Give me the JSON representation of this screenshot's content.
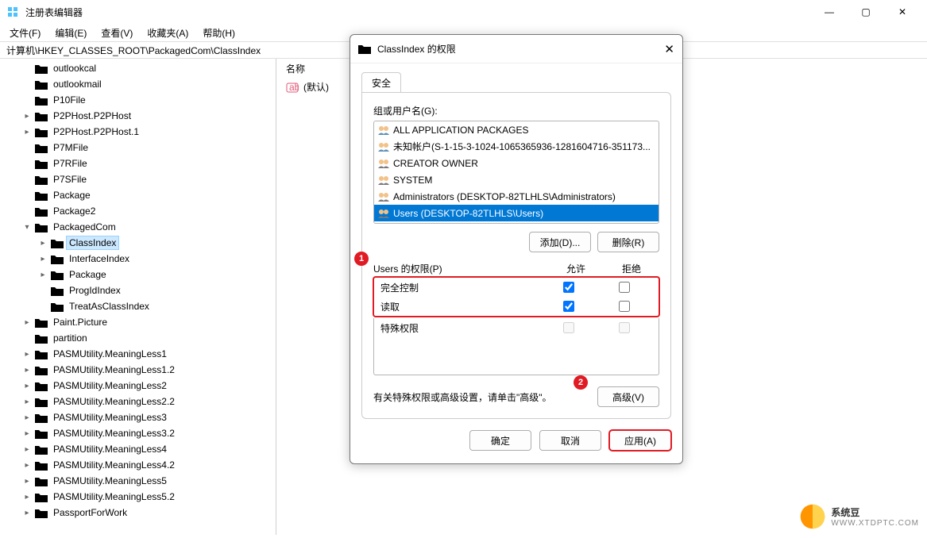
{
  "window": {
    "title": "注册表编辑器",
    "minimize": "—",
    "maximize": "▢",
    "close": "✕"
  },
  "menu": {
    "file": "文件(F)",
    "edit": "编辑(E)",
    "view": "查看(V)",
    "favorites": "收藏夹(A)",
    "help": "帮助(H)"
  },
  "address": "计算机\\HKEY_CLASSES_ROOT\\PackagedCom\\ClassIndex",
  "detail_header": {
    "name": "名称"
  },
  "detail_row": {
    "default": "(默认)"
  },
  "tree": [
    {
      "label": "outlookcal",
      "indent": 1,
      "caret": "none"
    },
    {
      "label": "outlookmail",
      "indent": 1,
      "caret": "none"
    },
    {
      "label": "P10File",
      "indent": 1,
      "caret": "none"
    },
    {
      "label": "P2PHost.P2PHost",
      "indent": 1,
      "caret": "right"
    },
    {
      "label": "P2PHost.P2PHost.1",
      "indent": 1,
      "caret": "right"
    },
    {
      "label": "P7MFile",
      "indent": 1,
      "caret": "none"
    },
    {
      "label": "P7RFile",
      "indent": 1,
      "caret": "none"
    },
    {
      "label": "P7SFile",
      "indent": 1,
      "caret": "none"
    },
    {
      "label": "Package",
      "indent": 1,
      "caret": "none"
    },
    {
      "label": "Package2",
      "indent": 1,
      "caret": "none"
    },
    {
      "label": "PackagedCom",
      "indent": 1,
      "caret": "down"
    },
    {
      "label": "ClassIndex",
      "indent": 2,
      "caret": "right",
      "selected": true
    },
    {
      "label": "InterfaceIndex",
      "indent": 2,
      "caret": "right"
    },
    {
      "label": "Package",
      "indent": 2,
      "caret": "right"
    },
    {
      "label": "ProgIdIndex",
      "indent": 2,
      "caret": "none"
    },
    {
      "label": "TreatAsClassIndex",
      "indent": 2,
      "caret": "none"
    },
    {
      "label": "Paint.Picture",
      "indent": 1,
      "caret": "right"
    },
    {
      "label": "partition",
      "indent": 1,
      "caret": "none"
    },
    {
      "label": "PASMUtility.MeaningLess1",
      "indent": 1,
      "caret": "right"
    },
    {
      "label": "PASMUtility.MeaningLess1.2",
      "indent": 1,
      "caret": "right"
    },
    {
      "label": "PASMUtility.MeaningLess2",
      "indent": 1,
      "caret": "right"
    },
    {
      "label": "PASMUtility.MeaningLess2.2",
      "indent": 1,
      "caret": "right"
    },
    {
      "label": "PASMUtility.MeaningLess3",
      "indent": 1,
      "caret": "right"
    },
    {
      "label": "PASMUtility.MeaningLess3.2",
      "indent": 1,
      "caret": "right"
    },
    {
      "label": "PASMUtility.MeaningLess4",
      "indent": 1,
      "caret": "right"
    },
    {
      "label": "PASMUtility.MeaningLess4.2",
      "indent": 1,
      "caret": "right"
    },
    {
      "label": "PASMUtility.MeaningLess5",
      "indent": 1,
      "caret": "right"
    },
    {
      "label": "PASMUtility.MeaningLess5.2",
      "indent": 1,
      "caret": "right"
    },
    {
      "label": "PassportForWork",
      "indent": 1,
      "caret": "right"
    }
  ],
  "dialog": {
    "title": "ClassIndex 的权限",
    "tab": "安全",
    "group_label": "组或用户名(G):",
    "principals": [
      {
        "name": "ALL APPLICATION PACKAGES",
        "type": "group"
      },
      {
        "name": "未知帐户(S-1-15-3-1024-1065365936-1281604716-351173...",
        "type": "group"
      },
      {
        "name": "CREATOR OWNER",
        "type": "user"
      },
      {
        "name": "SYSTEM",
        "type": "user"
      },
      {
        "name": "Administrators (DESKTOP-82TLHLS\\Administrators)",
        "type": "user"
      },
      {
        "name": "Users (DESKTOP-82TLHLS\\Users)",
        "type": "user",
        "selected": true
      }
    ],
    "add_btn": "添加(D)...",
    "remove_btn": "删除(R)",
    "perm_label": "Users 的权限(P)",
    "allow": "允许",
    "deny": "拒绝",
    "permissions": [
      {
        "name": "完全控制",
        "allow": true,
        "deny": false,
        "hl": true
      },
      {
        "name": "读取",
        "allow": true,
        "deny": false,
        "hl": true
      },
      {
        "name": "特殊权限",
        "allow": false,
        "deny": false,
        "disabled": true
      }
    ],
    "adv_hint": "有关特殊权限或高级设置，请单击\"高级\"。",
    "advanced_btn": "高级(V)",
    "ok": "确定",
    "cancel": "取消",
    "apply": "应用(A)",
    "badge1": "1",
    "badge2": "2"
  },
  "watermark": {
    "text": "系统豆",
    "sub": "WWW.XTDPTC.COM"
  }
}
